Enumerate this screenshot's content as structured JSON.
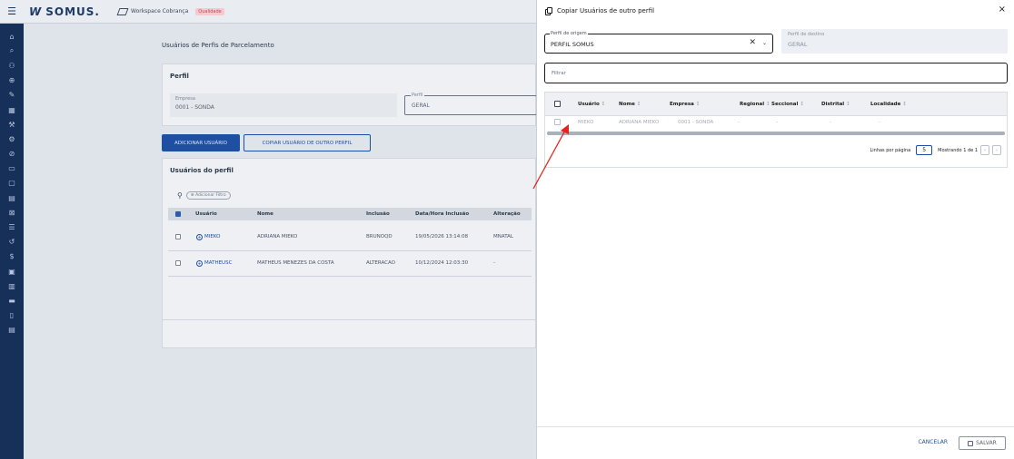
{
  "app": {
    "brand": "SOMUS.",
    "brand_mark": "W",
    "workspace": "Workspace Cobrança",
    "environment": "Qualidade"
  },
  "siderail": {
    "icons": [
      "home-icon",
      "search-icon",
      "users-icon",
      "plus-circle-icon",
      "edit-icon",
      "calculator-icon",
      "wrench-off-icon",
      "tools-icon",
      "block-icon",
      "clipboard-icon",
      "square-icon",
      "document-icon",
      "ban-icon",
      "list-icon",
      "history-icon",
      "dollar-icon",
      "id-card-icon",
      "calendar-icon",
      "money-icon",
      "file-icon",
      "file-text-icon"
    ]
  },
  "main": {
    "page_title": "Usuários de Perfis de Parcelamento",
    "perfil_card": {
      "title": "Perfil",
      "empresa_label": "Empresa",
      "empresa_value": "0001 - SONDA",
      "perfil_label": "Perfil",
      "perfil_value": "GERAL"
    },
    "buttons": {
      "add_user": "ADICIONAR USUÁRIO",
      "copy_user": "COPIAR USUÁRIO DE OUTRO PERFIL"
    },
    "users_card": {
      "title": "Usuários do perfil",
      "add_filter": "Adicionar Filtro",
      "columns": [
        "Usuário",
        "Nome",
        "Inclusão",
        "Data/Hora Inclusão",
        "Alteração"
      ],
      "rows": [
        [
          "MIEKO",
          "ADRIANA MIEKO",
          "BRUNOQD",
          "19/05/2026 13:14:08",
          "MNATAL"
        ],
        [
          "MATHEUSC",
          "MATHEUS MENEZES DA COSTA",
          "ALTERACAO",
          "10/12/2024 12:03:30",
          "-"
        ]
      ]
    }
  },
  "dialog": {
    "title": "Copiar Usuários de outro perfil",
    "close": "×",
    "source_label": "Perfil de origem",
    "source_value": "PERFIL SOMUS",
    "dest_label": "Perfil de destino",
    "dest_value": "GERAL",
    "filter_placeholder": "Filtrar",
    "columns": [
      "Usuário",
      "Nome",
      "Empresa",
      "Regional",
      "Seccional",
      "Distrital",
      "Localidade"
    ],
    "sort_glyph": "↕",
    "rows": [
      [
        "MIEKO",
        "ADRIANA MIEKO",
        "0001 - SONDA",
        "-",
        "-",
        "-",
        "-"
      ]
    ],
    "pager": {
      "rows_label": "Linhas por página",
      "rows_value": "5",
      "showing": "Mostrando 1 de 1",
      "prev": "‹",
      "next": "›"
    },
    "cancel": "CANCELAR",
    "save": "SALVAR"
  },
  "colors": {
    "rail": "#16305a",
    "primary": "#1e4fa3",
    "annotation_arrow": "#e8231f"
  }
}
